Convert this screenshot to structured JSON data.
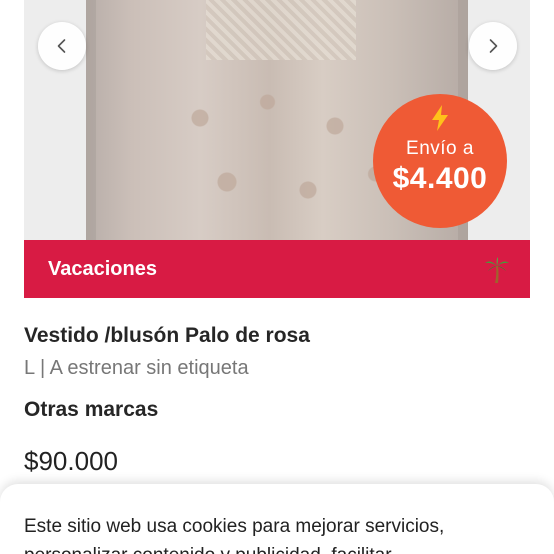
{
  "gallery": {
    "prev_icon": "chevron-left-icon",
    "next_icon": "chevron-right-icon"
  },
  "shipping_badge": {
    "icon": "lightning-bolt-icon",
    "label": "Envío a",
    "price": "$4.400",
    "color": "#ef5a35"
  },
  "promo": {
    "label": "Vacaciones",
    "icon": "palm-tree-icon",
    "color": "#d81b44"
  },
  "product": {
    "title": "Vestido /blusón Palo de rosa",
    "meta": "L | A estrenar sin etiqueta",
    "brand": "Otras marcas",
    "price": "$90.000"
  },
  "cookie_banner": {
    "text": "Este sitio web usa cookies para mejorar servicios, personalizar contenido y publicidad, facilitar"
  }
}
